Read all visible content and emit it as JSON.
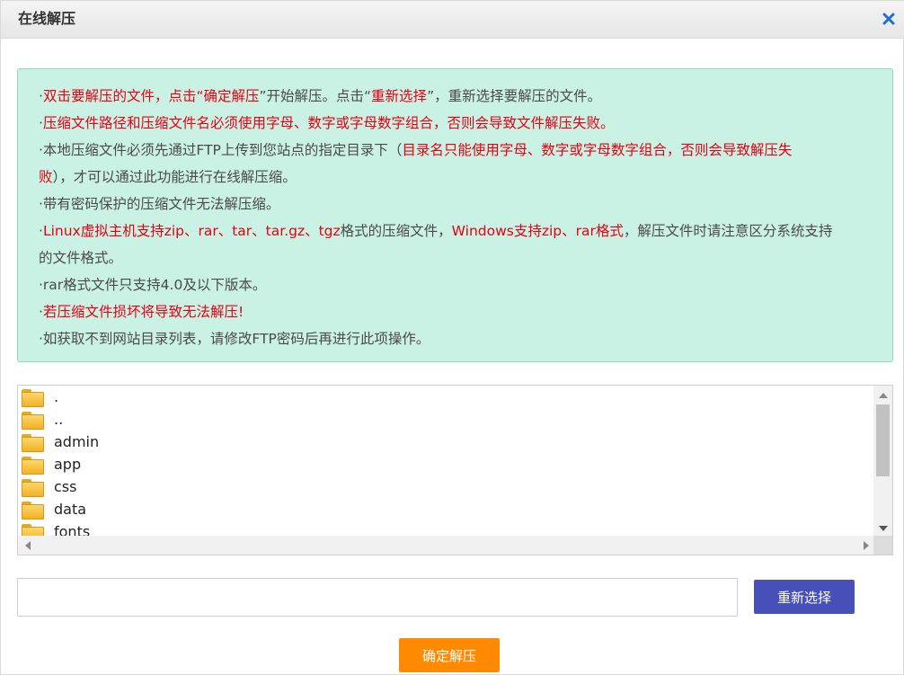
{
  "dialog": {
    "title": "在线解压",
    "close_icon": "close-icon"
  },
  "notice": {
    "lines": [
      [
        {
          "t": "·",
          "red": false
        },
        {
          "t": "双击要解压的文件，点击“",
          "red": true
        },
        {
          "t": "确定解压",
          "red": true
        },
        {
          "t": "”开始解压。点击“",
          "red": false
        },
        {
          "t": "重新选择",
          "red": true
        },
        {
          "t": "”，重新选择要解压的文件。",
          "red": false
        }
      ],
      [
        {
          "t": "·",
          "red": false
        },
        {
          "t": "压缩文件路径和压缩文件名必须使用字母、数字或字母数字组合，否则会导致文件解压失败。",
          "red": true
        }
      ],
      [
        {
          "t": "·本地压缩文件必须先通过FTP上传到您站点的指定目录下（",
          "red": false
        },
        {
          "t": "目录名只能使用字母、数字或字母数字组合，否则会导致解压失",
          "red": true
        }
      ],
      [
        {
          "t": "败",
          "red": true
        },
        {
          "t": "），才可以通过此功能进行在线解压缩。",
          "red": false
        }
      ],
      [
        {
          "t": "·带有密码保护的压缩文件无法解压缩。",
          "red": false
        }
      ],
      [
        {
          "t": "·",
          "red": false
        },
        {
          "t": "Linux虚拟主机支持",
          "red": true
        },
        {
          "t": "zip、rar、tar、tar.gz、tgz",
          "red": true
        },
        {
          "t": "格式的压缩文件，",
          "red": false
        },
        {
          "t": "Windows支持zip、rar格式",
          "red": true
        },
        {
          "t": "，解压文件时请注意区分系统支持",
          "red": false
        }
      ],
      [
        {
          "t": "的文件格式。",
          "red": false
        }
      ],
      [
        {
          "t": "·rar格式文件只支持4.0及以下版本。",
          "red": false
        }
      ],
      [
        {
          "t": "·",
          "red": false
        },
        {
          "t": "若压缩文件损坏将导致无法解压!",
          "red": true
        }
      ],
      [
        {
          "t": "·如获取不到网站目录列表，请修改FTP密码后再进行此项操作。",
          "red": false
        }
      ]
    ]
  },
  "file_list": {
    "items": [
      ".",
      "..",
      "admin",
      "app",
      "css",
      "data",
      "fonts"
    ],
    "item_icon": "folder-icon"
  },
  "path_field": {
    "value": "",
    "placeholder": ""
  },
  "buttons": {
    "reselect_label": "重新选择",
    "confirm_label": "确定解压"
  },
  "colors": {
    "notice_bg": "#c9f1e4",
    "notice_border": "#8fd9be",
    "warning_red": "#e60012",
    "reselect_bg": "#4650b8",
    "confirm_bg": "#ff8a00"
  }
}
